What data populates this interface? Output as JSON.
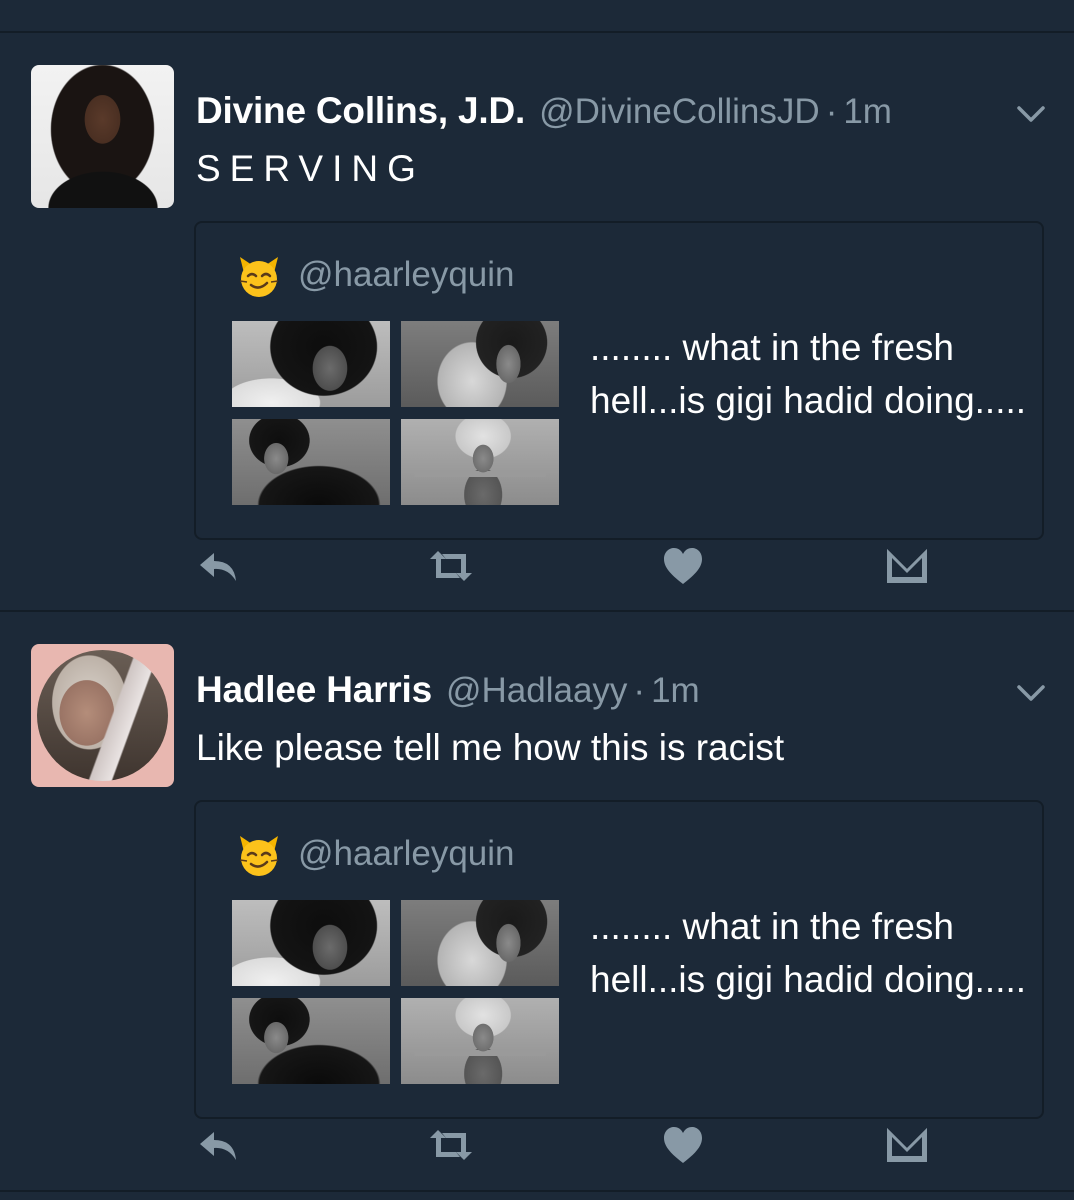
{
  "colors": {
    "background": "#1c2938",
    "divider": "#131d27",
    "text_primary": "#ffffff",
    "text_secondary": "#8899a6",
    "icon": "#8899a6"
  },
  "tweets": [
    {
      "name": "Divine Collins, J.D.",
      "handle": "@DivineCollinsJD",
      "separator": "·",
      "time": "1m",
      "text": "SERVING",
      "quote": {
        "icon": "smirking-cat-emoji",
        "handle": "@haarleyquin",
        "text": "........ what in the fresh hell...is gigi hadid doing....."
      },
      "actions": [
        "reply-icon",
        "retweet-icon",
        "like-heart-icon",
        "direct-message-icon"
      ]
    },
    {
      "name": "Hadlee Harris",
      "handle": "@Hadlaayy",
      "separator": "·",
      "time": "1m",
      "text": "Like please tell me how this is racist",
      "quote": {
        "icon": "smirking-cat-emoji",
        "handle": "@haarleyquin",
        "text": "........ what in the fresh hell...is gigi hadid doing....."
      },
      "actions": [
        "reply-icon",
        "retweet-icon",
        "like-heart-icon",
        "direct-message-icon"
      ]
    }
  ]
}
